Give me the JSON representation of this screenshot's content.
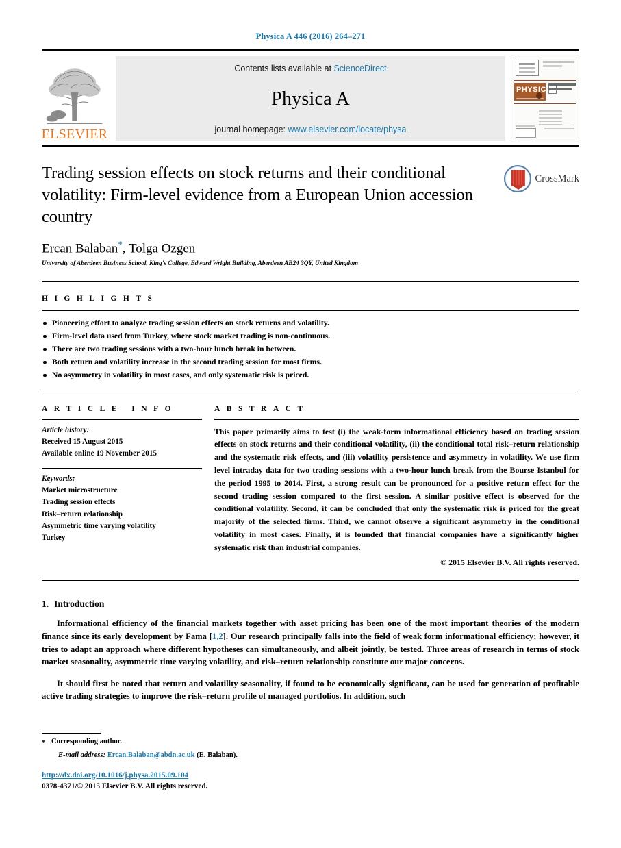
{
  "running_head": "Physica A 446 (2016) 264–271",
  "masthead": {
    "elsevier_wordmark": "ELSEVIER",
    "contents_prefix": "Contents lists available at ",
    "contents_link": "ScienceDirect",
    "journal_name": "Physica A",
    "homepage_prefix": "journal homepage: ",
    "homepage_link": "www.elsevier.com/locate/physa",
    "cover_band_text": "PHYSICA"
  },
  "title_block": {
    "title": "Trading session effects on stock returns and their conditional volatility: Firm-level evidence from a European Union accession country",
    "authors": "Ercan Balaban",
    "author_marker": "*",
    "authors_rest": ", Tolga Ozgen",
    "affiliation": "University of Aberdeen Business School, King's College, Edward Wright Building, Aberdeen AB24 3QY, United Kingdom",
    "crossmark_label": "CrossMark"
  },
  "highlights": {
    "heading": "HIGHLIGHTS",
    "items": [
      "Pioneering effort to analyze trading session effects on stock returns and volatility.",
      "Firm-level data used from Turkey, where stock market trading is non-continuous.",
      "There are two trading sessions with a two-hour lunch break in between.",
      "Both return and volatility increase in the second trading session for most firms.",
      "No asymmetry in volatility in most cases, and only systematic risk is priced."
    ]
  },
  "article_info": {
    "heading": "ARTICLE INFO",
    "history_label": "Article history:",
    "history_lines": [
      "Received 15 August 2015",
      "Available online 19 November 2015"
    ],
    "keywords_label": "Keywords:",
    "keywords": [
      "Market microstructure",
      "Trading session effects",
      "Risk–return relationship",
      "Asymmetric time varying volatility",
      "Turkey"
    ]
  },
  "abstract": {
    "heading": "ABSTRACT",
    "text": "This paper primarily aims to test (i) the weak-form informational efficiency based on trading session effects on stock returns and their conditional volatility, (ii) the conditional total risk–return relationship and the systematic risk effects, and (iii) volatility persistence and asymmetry in volatility. We use firm level intraday data for two trading sessions with a two-hour lunch break from the Bourse Istanbul for the period 1995 to 2014. First, a strong result can be pronounced for a positive return effect for the second trading session compared to the first session. A similar positive effect is observed for the conditional volatility. Second, it can be concluded that only the systematic risk is priced for the great majority of the selected firms. Third, we cannot observe a significant asymmetry in the conditional volatility in most cases. Finally, it is founded that financial companies have a significantly higher systematic risk than industrial companies.",
    "copyright": "© 2015 Elsevier B.V. All rights reserved."
  },
  "body": {
    "section_number": "1.",
    "section_title": "Introduction",
    "paragraph_1_a": "Informational efficiency of the financial markets together with asset pricing has been one of the most important theories of the modern finance since its early development by Fama [",
    "paragraph_1_refs": "1,2",
    "paragraph_1_b": "]. Our research principally falls into the field of weak form informational efficiency; however, it tries to adapt an approach where different hypotheses can simultaneously, and albeit jointly, be tested. Three areas of research in terms of stock market seasonality, asymmetric time varying volatility, and risk–return relationship constitute our major concerns.",
    "paragraph_2": "It should first be noted that return and volatility seasonality, if found to be economically significant, can be used for generation of profitable active trading strategies to improve the risk–return profile of managed portfolios. In addition, such"
  },
  "footnote": {
    "star": "*",
    "corresponding": "Corresponding author.",
    "email_label": "E-mail address:",
    "email": "Ercan.Balaban@abdn.ac.uk",
    "email_suffix": "(E. Balaban).",
    "doi": "http://dx.doi.org/10.1016/j.physa.2015.09.104",
    "issn": "0378-4371/© 2015 Elsevier B.V. All rights reserved."
  },
  "colors": {
    "link_blue": "#1a7aab",
    "elsevier_orange": "#E87722",
    "masthead_grey": "#ebebeb"
  }
}
